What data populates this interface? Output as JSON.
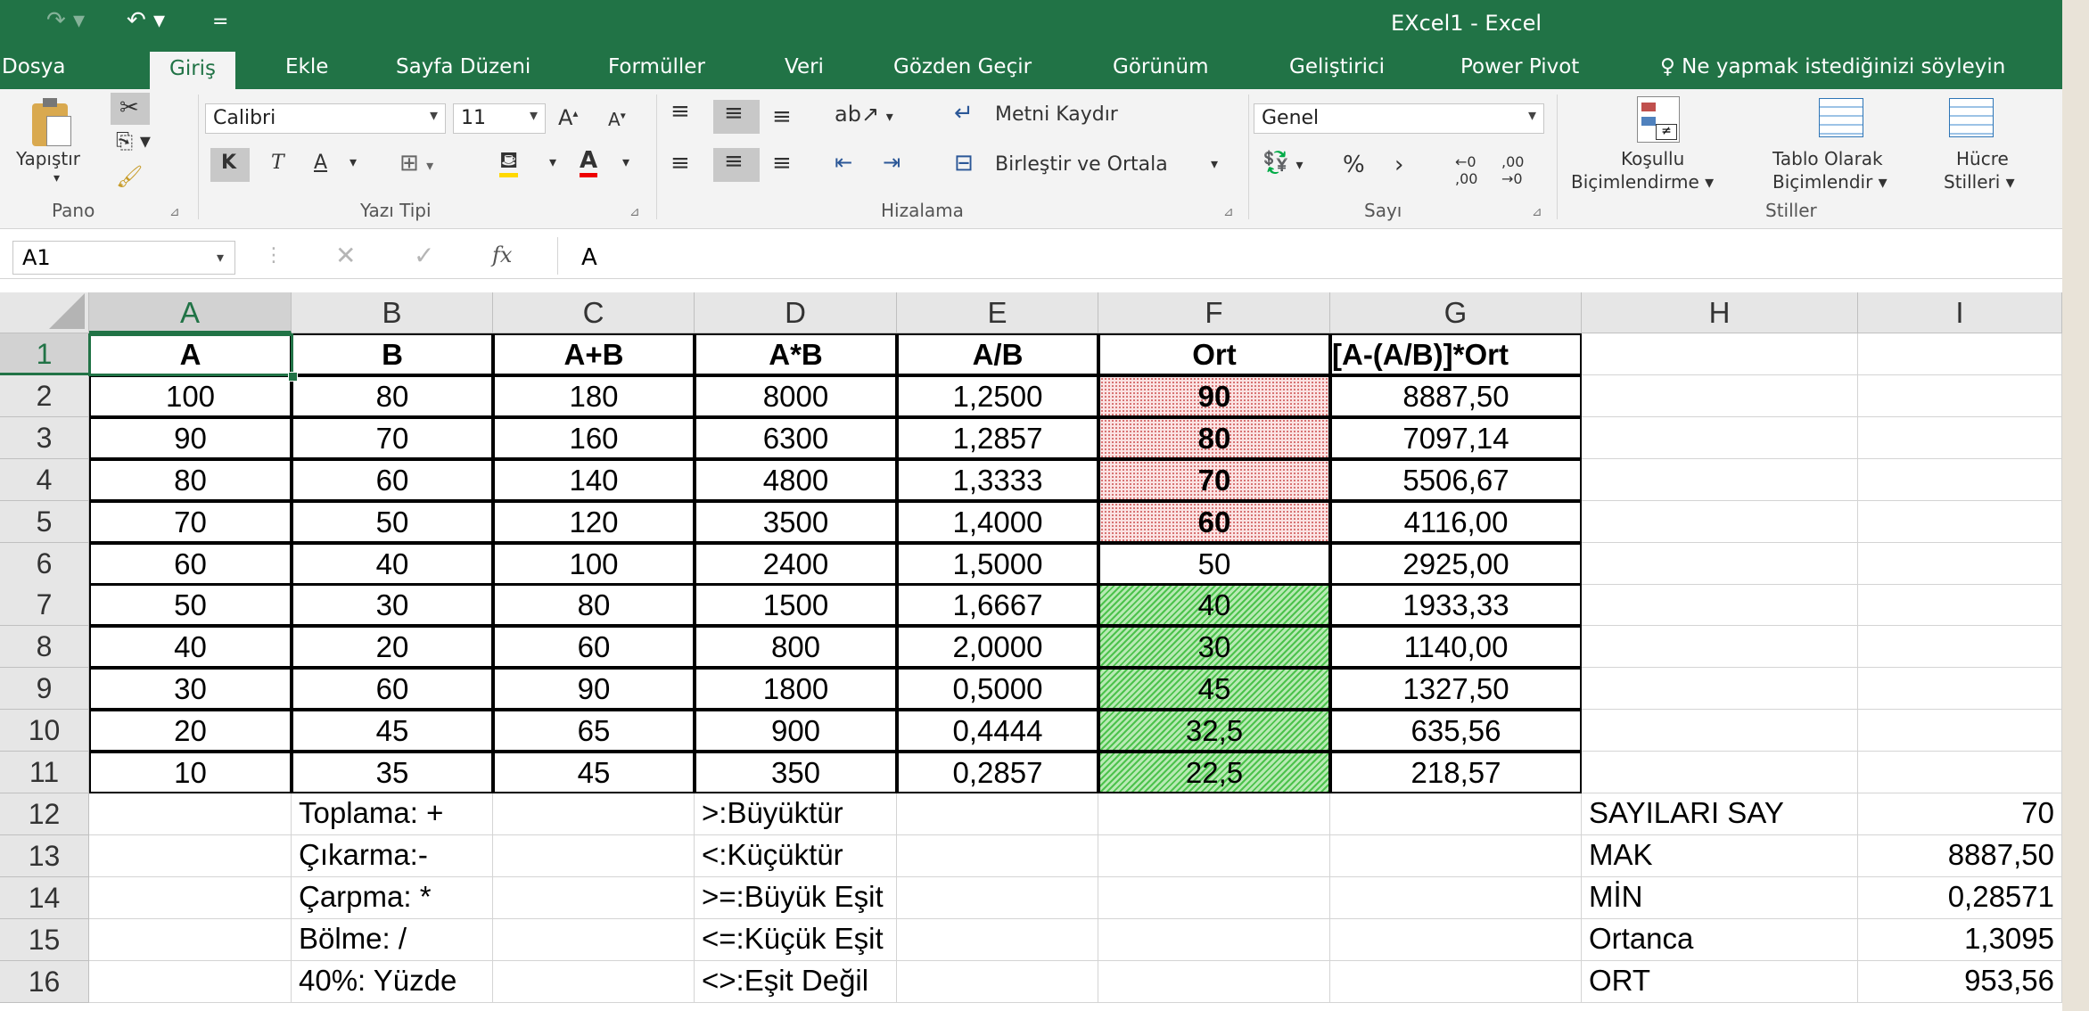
{
  "app": {
    "title": "EXcel1 - Excel"
  },
  "qat": {
    "redo": "⤻",
    "undo": "↶",
    "customize": "="
  },
  "tabs": [
    "Dosya",
    "Giriş",
    "Ekle",
    "Sayfa Düzeni",
    "Formüller",
    "Veri",
    "Gözden Geçir",
    "Görünüm",
    "Geliştirici",
    "Power Pivot",
    "Ne yapmak istediğinizi söyleyin"
  ],
  "ribbon": {
    "clipboard": {
      "paste": "Yapıştır",
      "label": "Pano"
    },
    "font": {
      "name": "Calibri",
      "size": "11",
      "bold": "K",
      "italic": "T",
      "underline": "A",
      "label": "Yazı Tipi"
    },
    "alignment": {
      "wrap": "Metni Kaydır",
      "merge": "Birleştir ve Ortala",
      "label": "Hizalama"
    },
    "number": {
      "format": "Genel",
      "percent": "%",
      "comma": "›",
      "inc": "←,0 ,00",
      "dec": ",00 →,0",
      "label": "Sayı"
    },
    "styles": {
      "conditional": [
        "Koşullu",
        "Biçimlendirme"
      ],
      "table": [
        "Tablo Olarak",
        "Biçimlendir"
      ],
      "cell": [
        "Hücre",
        "Stilleri"
      ],
      "label": "Stiller"
    }
  },
  "formula": {
    "name_box": "A1",
    "content": "A",
    "fx": "fx"
  },
  "sheet": {
    "columns": [
      "A",
      "B",
      "C",
      "D",
      "E",
      "F",
      "G",
      "H",
      "I"
    ],
    "rows": [
      [
        "A",
        "B",
        "A+B",
        "A*B",
        "A/B",
        "Ort",
        "[A-(A/B)]*Ort",
        "",
        ""
      ],
      [
        "100",
        "80",
        "180",
        "8000",
        "1,2500",
        "90",
        "8887,50",
        "",
        ""
      ],
      [
        "90",
        "70",
        "160",
        "6300",
        "1,2857",
        "80",
        "7097,14",
        "",
        ""
      ],
      [
        "80",
        "60",
        "140",
        "4800",
        "1,3333",
        "70",
        "5506,67",
        "",
        ""
      ],
      [
        "70",
        "50",
        "120",
        "3500",
        "1,4000",
        "60",
        "4116,00",
        "",
        ""
      ],
      [
        "60",
        "40",
        "100",
        "2400",
        "1,5000",
        "50",
        "2925,00",
        "",
        ""
      ],
      [
        "50",
        "30",
        "80",
        "1500",
        "1,6667",
        "40",
        "1933,33",
        "",
        ""
      ],
      [
        "40",
        "20",
        "60",
        "800",
        "2,0000",
        "30",
        "1140,00",
        "",
        ""
      ],
      [
        "30",
        "60",
        "90",
        "1800",
        "0,5000",
        "45",
        "1327,50",
        "",
        ""
      ],
      [
        "20",
        "45",
        "65",
        "900",
        "0,4444",
        "32,5",
        "635,56",
        "",
        ""
      ],
      [
        "10",
        "35",
        "45",
        "350",
        "0,2857",
        "22,5",
        "218,57",
        "",
        ""
      ],
      [
        "",
        "Toplama: +",
        "",
        "&gt;:Büyüktür",
        "",
        "",
        "",
        "SAYILARI SAY",
        "70"
      ],
      [
        "",
        "Çıkarma:-",
        "",
        "&lt;:Küçüktür",
        "",
        "",
        "",
        "MAK",
        "8887,50"
      ],
      [
        "",
        "Çarpma: *",
        "",
        "&gt;=:Büyük Eşit",
        "",
        "",
        "",
        "MİN",
        "0,28571"
      ],
      [
        "",
        "Bölme: /",
        "",
        "&lt;=:Küçük Eşit",
        "",
        "",
        "",
        "Ortanca",
        "1,3095"
      ],
      [
        "",
        "40%: Yüzde",
        "",
        "&lt;&gt;:Eşit Değil",
        "",
        "",
        "",
        "ORT",
        "953,56"
      ]
    ]
  }
}
